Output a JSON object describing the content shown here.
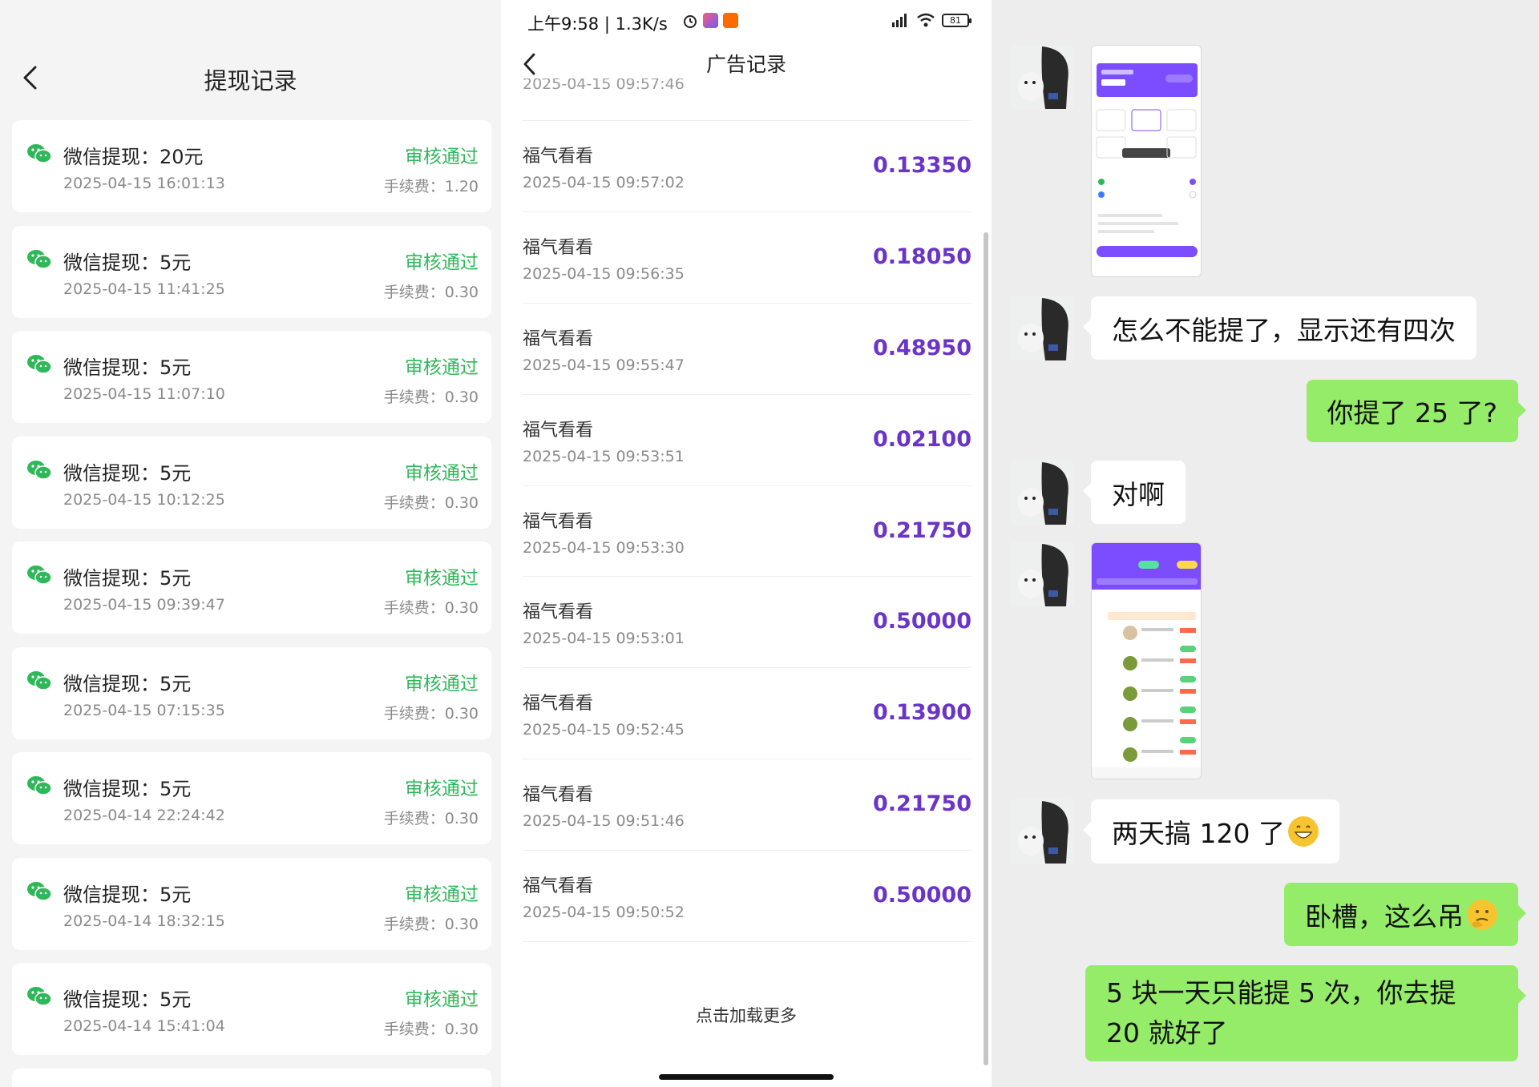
{
  "left": {
    "title": "提现记录",
    "records": [
      {
        "title": "微信提现：20元",
        "time": "2025-04-15 16:01:13",
        "status": "审核通过",
        "fee": "手续费：1.20"
      },
      {
        "title": "微信提现：5元",
        "time": "2025-04-15 11:41:25",
        "status": "审核通过",
        "fee": "手续费：0.30"
      },
      {
        "title": "微信提现：5元",
        "time": "2025-04-15 11:07:10",
        "status": "审核通过",
        "fee": "手续费：0.30"
      },
      {
        "title": "微信提现：5元",
        "time": "2025-04-15 10:12:25",
        "status": "审核通过",
        "fee": "手续费：0.30"
      },
      {
        "title": "微信提现：5元",
        "time": "2025-04-15 09:39:47",
        "status": "审核通过",
        "fee": "手续费：0.30"
      },
      {
        "title": "微信提现：5元",
        "time": "2025-04-15 07:15:35",
        "status": "审核通过",
        "fee": "手续费：0.30"
      },
      {
        "title": "微信提现：5元",
        "time": "2025-04-14 22:24:42",
        "status": "审核通过",
        "fee": "手续费：0.30"
      },
      {
        "title": "微信提现：5元",
        "time": "2025-04-14 18:32:15",
        "status": "审核通过",
        "fee": "手续费：0.30"
      },
      {
        "title": "微信提现：5元",
        "time": "2025-04-14 15:41:04",
        "status": "审核通过",
        "fee": "手续费：0.30"
      }
    ]
  },
  "mid": {
    "status_bar": {
      "time": "上午9:58 | 1.3K/s",
      "battery": "81"
    },
    "title": "广告记录",
    "cut_row": "2025-04-15 09:57:46",
    "records": [
      {
        "name": "福气看看",
        "time": "2025-04-15 09:57:02",
        "amount": "0.13350"
      },
      {
        "name": "福气看看",
        "time": "2025-04-15 09:56:35",
        "amount": "0.18050"
      },
      {
        "name": "福气看看",
        "time": "2025-04-15 09:55:47",
        "amount": "0.48950"
      },
      {
        "name": "福气看看",
        "time": "2025-04-15 09:53:51",
        "amount": "0.02100"
      },
      {
        "name": "福气看看",
        "time": "2025-04-15 09:53:30",
        "amount": "0.21750"
      },
      {
        "name": "福气看看",
        "time": "2025-04-15 09:53:01",
        "amount": "0.50000"
      },
      {
        "name": "福气看看",
        "time": "2025-04-15 09:52:45",
        "amount": "0.13900"
      },
      {
        "name": "福气看看",
        "time": "2025-04-15 09:51:46",
        "amount": "0.21750"
      },
      {
        "name": "福气看看",
        "time": "2025-04-15 09:50:52",
        "amount": "0.50000"
      }
    ],
    "load_more": "点击加载更多"
  },
  "chat": {
    "messages": [
      {
        "side": "left",
        "text": "怎么不能提了，显示还有四次"
      },
      {
        "side": "right",
        "text": "你提了 25 了?"
      },
      {
        "side": "left",
        "text": "对啊"
      },
      {
        "side": "left",
        "text": "两天搞 120 了"
      },
      {
        "side": "right",
        "text": "卧槽，这么吊"
      },
      {
        "side": "right",
        "text": "5 块一天只能提 5 次，你去提 20 就好了"
      }
    ]
  },
  "colors": {
    "approved": "#2fb85a",
    "amount": "#6a34c8",
    "bubble_right": "#95ec69",
    "chat_bg": "#ededed"
  }
}
